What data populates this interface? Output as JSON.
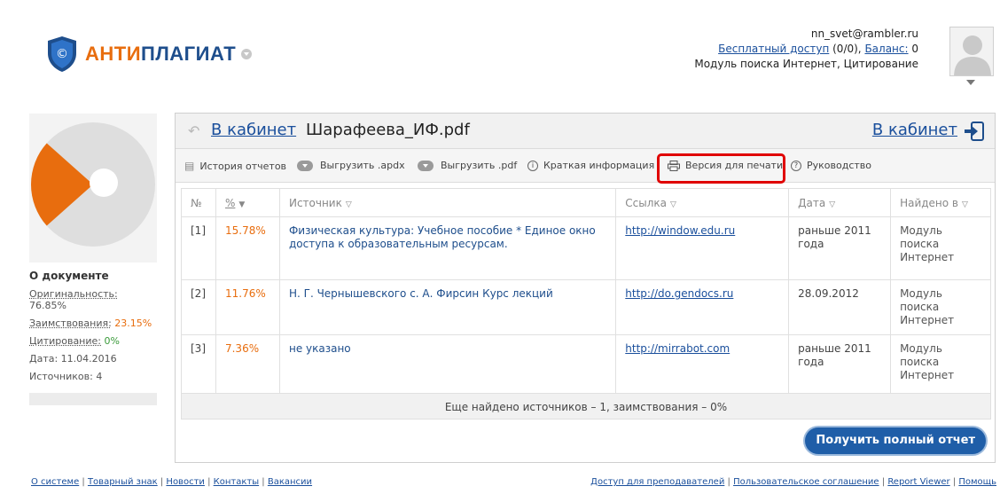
{
  "header": {
    "logo_part1": "АНТИ",
    "logo_part2": "ПЛАГИАТ",
    "user_email": "nn_svet@rambler.ru",
    "free_access": "Бесплатный доступ",
    "free_access_count": " (0/0), ",
    "balance_label": "Баланс:",
    "balance_value": " 0",
    "modules": "Модуль поиска Интернет, Цитирование"
  },
  "document": {
    "title": "О документе",
    "originality_label": "Оригинальность:",
    "originality_value": " 76.85%",
    "borrowing_label": "Заимствования:",
    "borrowing_value": " 23.15%",
    "citation_label": "Цитирование:",
    "citation_value": " 0%",
    "date": "Дата: 11.04.2016",
    "sources": "Источников: 4",
    "pie": {
      "originality": 76.85,
      "borrowing": 23.15,
      "citation": 0
    }
  },
  "main": {
    "cabinet_link": "В кабинет",
    "file_name": "Шарафеева_ИФ.pdf",
    "cabinet_link_right": "В кабинет",
    "toolbar": {
      "history": "История отчетов",
      "export_apdx": "Выгрузить .apdx",
      "export_pdf": "Выгрузить .pdf",
      "brief": "Краткая информация",
      "print": "Версия для печати",
      "guide": "Руководство"
    },
    "table": {
      "headers": [
        "№",
        "%",
        "Источник",
        "Ссылка",
        "Дата",
        "Найдено в"
      ],
      "rows": [
        {
          "num": "[1]",
          "pct": "15.78%",
          "source": "Физическая культура: Учебное пособие * Единое окно доступа к образовательным ресурсам.",
          "link": "http://window.edu.ru",
          "date": "раньше 2011 года",
          "found": "Модуль поиска Интернет"
        },
        {
          "num": "[2]",
          "pct": "11.76%",
          "source": "Н. Г. Чернышевского с. А. Фирсин Курс лекций",
          "link": "http://do.gendocs.ru",
          "date": "28.09.2012",
          "found": "Модуль поиска Интернет"
        },
        {
          "num": "[3]",
          "pct": "7.36%",
          "source": "не указано",
          "link": "http://mirrabot.com",
          "date": "раньше 2011 года",
          "found": "Модуль поиска Интернет"
        }
      ]
    },
    "more_sources": "Еще найдено источников – 1, заимствования – 0%",
    "full_report_button": "Получить полный отчет"
  },
  "footer": {
    "left": [
      "О системе",
      "Товарный знак",
      "Новости",
      "Контакты",
      "Вакансии"
    ],
    "right": [
      "Доступ для преподавателей",
      "Пользовательское соглашение",
      "Report Viewer",
      "Помощь"
    ]
  },
  "colors": {
    "accent": "#e86d0e",
    "brand": "#1e4e8c",
    "highlight": "#e00000"
  }
}
